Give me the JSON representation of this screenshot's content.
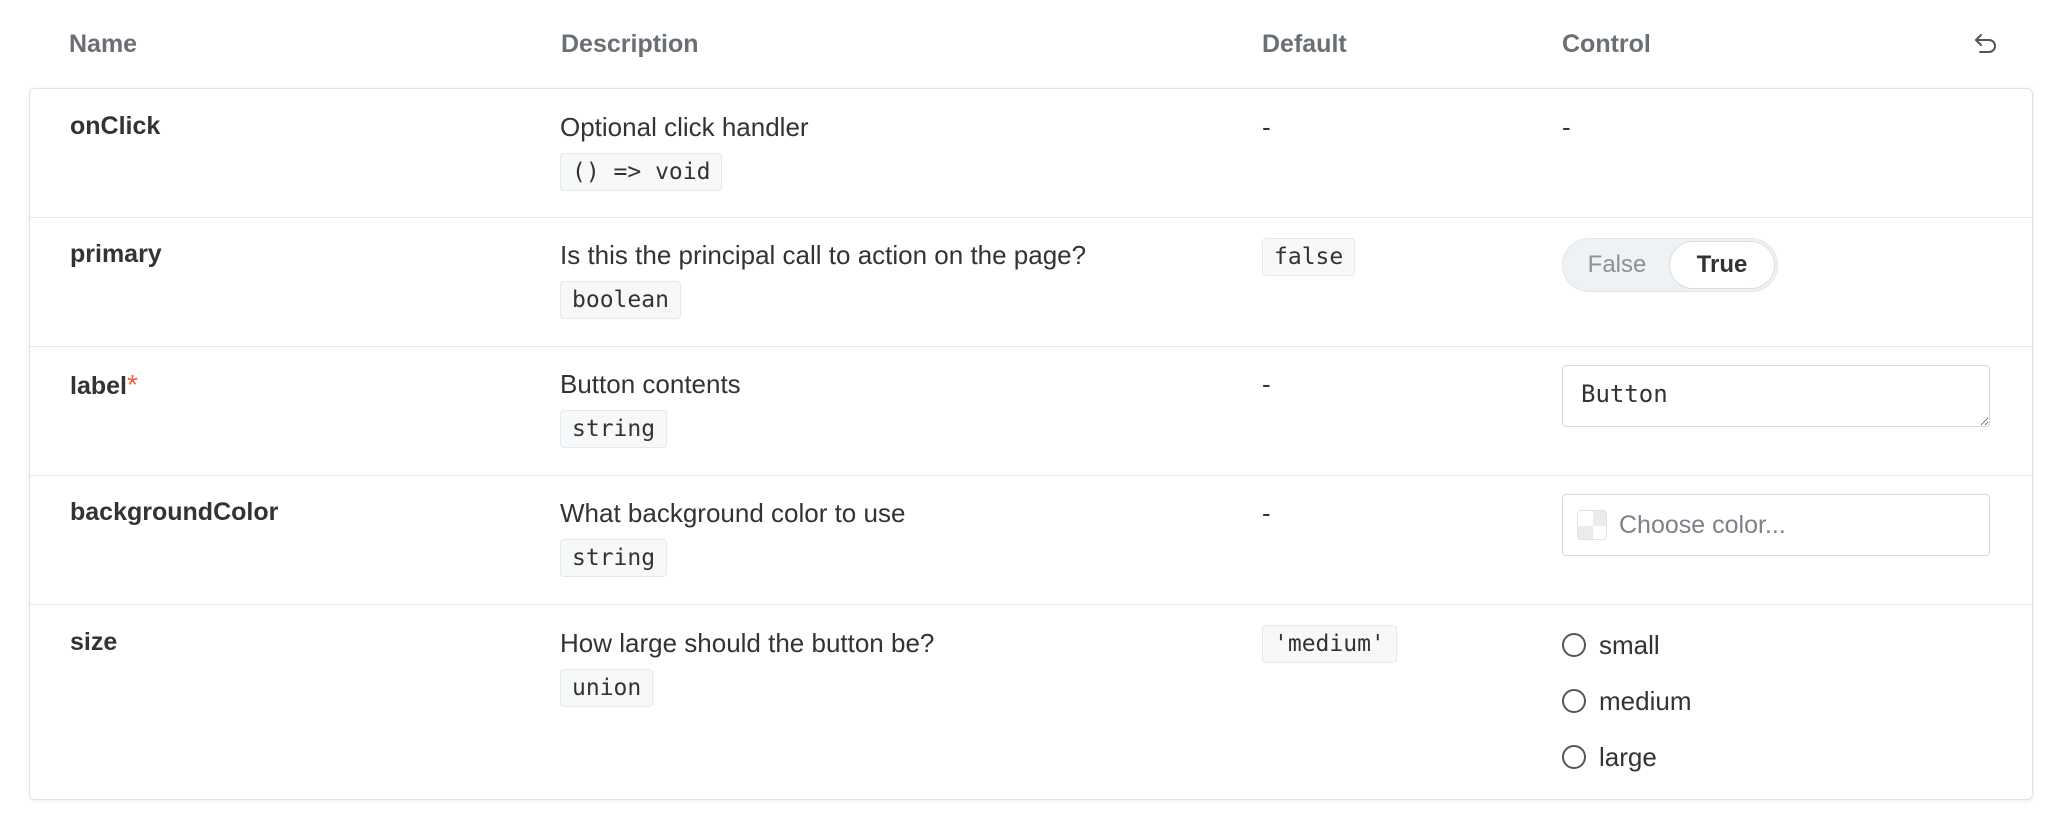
{
  "header": {
    "name": "Name",
    "description": "Description",
    "default": "Default",
    "control": "Control",
    "reset_icon": "undo-icon"
  },
  "rows": [
    {
      "name": "onClick",
      "description": "Optional click handler",
      "type": "() => void",
      "default": "-",
      "control": "-"
    },
    {
      "name": "primary",
      "description": "Is this the principal call to action on the page?",
      "type": "boolean",
      "default": "false",
      "toggle": {
        "false_label": "False",
        "true_label": "True",
        "selected": "True"
      }
    },
    {
      "name": "label",
      "required_mark": "*",
      "description": "Button contents",
      "type": "string",
      "default": "-",
      "text_value": "Button"
    },
    {
      "name": "backgroundColor",
      "description": "What background color to use",
      "type": "string",
      "default": "-",
      "color_placeholder": "Choose color..."
    },
    {
      "name": "size",
      "description": "How large should the button be?",
      "type": "union",
      "default": "'medium'",
      "options": [
        "small",
        "medium",
        "large"
      ]
    }
  ],
  "colors": {
    "required": "#e8603c",
    "header_text": "#6a6f75",
    "border": "#dfe3e7"
  }
}
